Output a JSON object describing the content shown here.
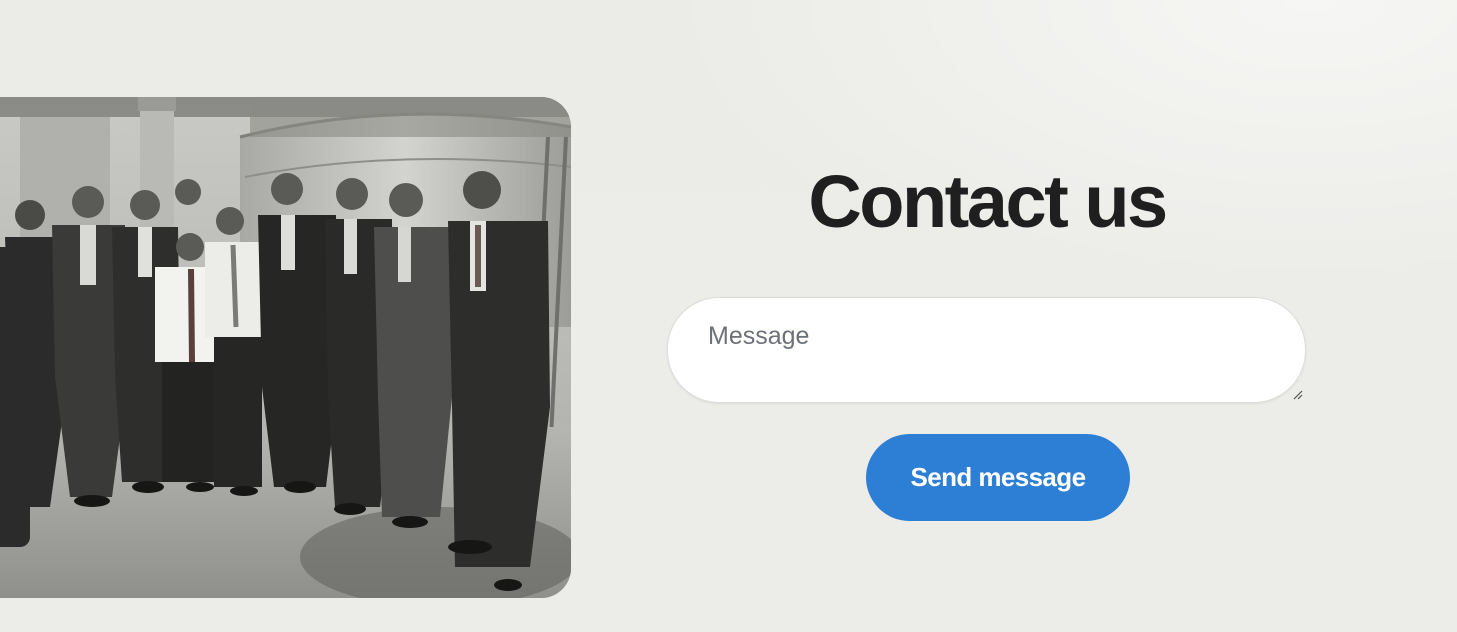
{
  "contact": {
    "title": "Contact us",
    "message_placeholder": "Message",
    "send_label": "Send message"
  },
  "photo": {
    "alt": "group photo"
  },
  "colors": {
    "background": "#ecede9",
    "title_text": "#1f1f1f",
    "button_bg": "#2d7fd5",
    "button_text": "#ffffff",
    "input_bg": "#ffffff",
    "placeholder": "#6d7177"
  }
}
